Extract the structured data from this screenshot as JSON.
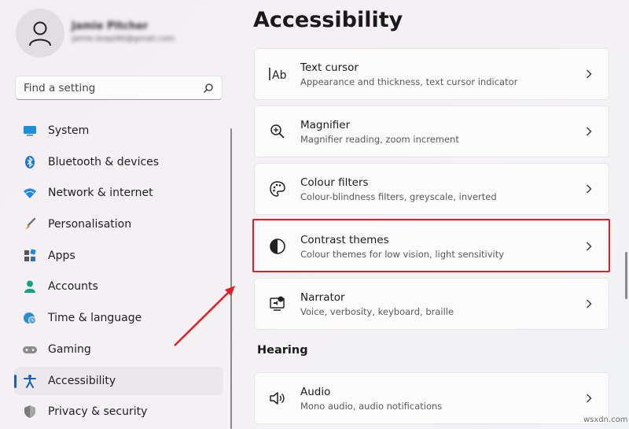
{
  "user": {
    "name": "Jamie Pitcher",
    "email": "jamie.teapi90@gmail.com"
  },
  "search": {
    "placeholder": "Find a setting"
  },
  "nav": [
    {
      "label": "System",
      "icon": "monitor-icon"
    },
    {
      "label": "Bluetooth & devices",
      "icon": "bluetooth-icon"
    },
    {
      "label": "Network & internet",
      "icon": "wifi-icon"
    },
    {
      "label": "Personalisation",
      "icon": "brush-icon"
    },
    {
      "label": "Apps",
      "icon": "apps-icon"
    },
    {
      "label": "Accounts",
      "icon": "person-icon"
    },
    {
      "label": "Time & language",
      "icon": "globe-clock-icon"
    },
    {
      "label": "Gaming",
      "icon": "gamepad-icon"
    },
    {
      "label": "Accessibility",
      "icon": "accessibility-icon",
      "active": true
    },
    {
      "label": "Privacy & security",
      "icon": "shield-icon"
    }
  ],
  "page": {
    "title": "Accessibility"
  },
  "cards": [
    {
      "title": "Text cursor",
      "subtitle": "Appearance and thickness, text cursor indicator",
      "icon": "text-cursor-icon"
    },
    {
      "title": "Magnifier",
      "subtitle": "Magnifier reading, zoom increment",
      "icon": "magnifier-icon"
    },
    {
      "title": "Colour filters",
      "subtitle": "Colour-blindness filters, greyscale, inverted",
      "icon": "palette-icon"
    },
    {
      "title": "Contrast themes",
      "subtitle": "Colour themes for low vision, light sensitivity",
      "icon": "contrast-icon",
      "highlighted": true
    },
    {
      "title": "Narrator",
      "subtitle": "Voice, verbosity, keyboard, braille",
      "icon": "narrator-icon"
    }
  ],
  "hearing": {
    "heading": "Hearing",
    "cards": [
      {
        "title": "Audio",
        "subtitle": "Mono audio, audio notifications",
        "icon": "speaker-icon"
      }
    ]
  },
  "watermark": "wsxdn.com",
  "colors": {
    "highlight": "#e01e24",
    "accent": "#1a5fb4"
  }
}
